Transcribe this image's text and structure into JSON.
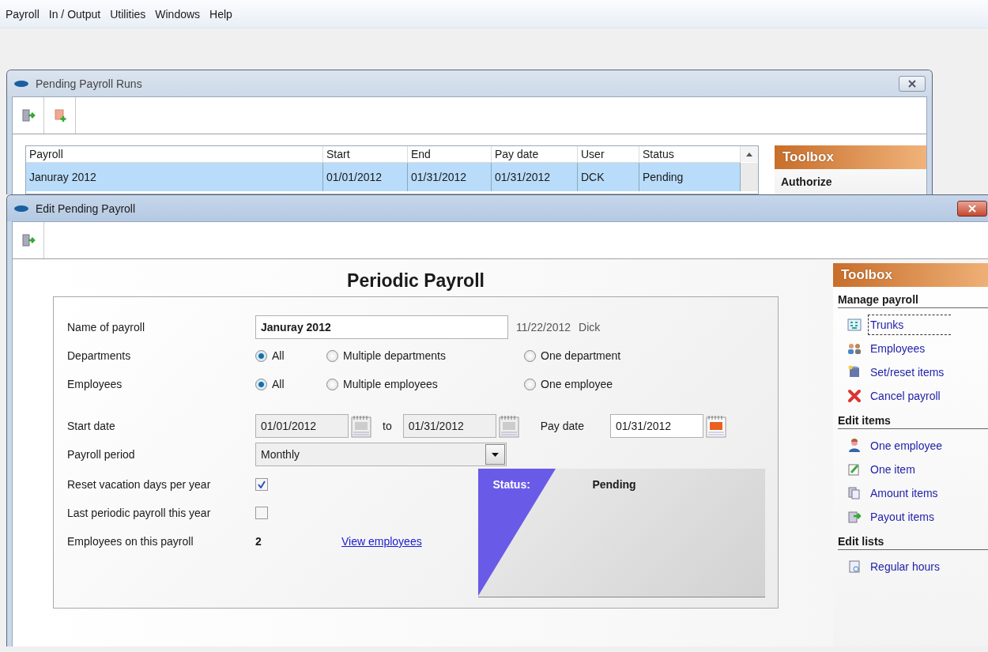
{
  "menu": [
    "Payroll",
    "In / Output",
    "Utilities",
    "Windows",
    "Help"
  ],
  "runs_window": {
    "title": "Pending Payroll Runs",
    "active": false,
    "columns": [
      "Payroll",
      "Start",
      "End",
      "Pay date",
      "User",
      "Status"
    ],
    "rows": [
      {
        "cells": [
          "Januray 2012",
          "01/01/2012",
          "01/31/2012",
          "01/31/2012",
          "DCK",
          "Pending"
        ],
        "selected": true
      }
    ],
    "toolbox": {
      "title": "Toolbox",
      "heading": "Authorize"
    }
  },
  "edit_window": {
    "title": "Edit Pending Payroll",
    "active": true,
    "heading": "Periodic Payroll",
    "form": {
      "name": {
        "label": "Name of payroll",
        "value": "Januray 2012",
        "created": "11/22/2012",
        "user": "Dick"
      },
      "radio_groups": [
        {
          "label": "Departments",
          "options": [
            {
              "label": "All",
              "selected": true
            },
            {
              "label": "Multiple departments",
              "selected": false
            },
            {
              "label": "One department",
              "selected": false
            }
          ]
        },
        {
          "label": "Employees",
          "options": [
            {
              "label": "All",
              "selected": true
            },
            {
              "label": "Multiple employees",
              "selected": false
            },
            {
              "label": "One employee",
              "selected": false
            }
          ]
        }
      ],
      "dates": {
        "start_label": "Start date",
        "to_label": "to",
        "pay_label": "Pay date",
        "fields": [
          {
            "value": "01/01/2012",
            "disabled": true
          },
          {
            "value": "01/31/2012",
            "disabled": true
          },
          {
            "value": "01/31/2012",
            "disabled": false
          }
        ]
      },
      "period": {
        "label": "Payroll period",
        "value": "Monthly"
      },
      "checks": [
        {
          "label": "Reset vacation days per year",
          "checked": true
        },
        {
          "label": "Last periodic payroll this year",
          "checked": false
        }
      ],
      "count": {
        "label": "Employees on this payroll",
        "value": "2",
        "link": "View employees"
      },
      "status": {
        "label": "Status:",
        "value": "Pending"
      }
    },
    "toolbox": {
      "title": "Toolbox",
      "sections": [
        {
          "title": "Manage payroll",
          "items": [
            {
              "label": "Trunks",
              "focused": true
            },
            {
              "label": "Employees",
              "focused": false
            },
            {
              "label": "Set/reset items",
              "focused": false
            },
            {
              "label": "Cancel payroll",
              "focused": false
            }
          ]
        },
        {
          "title": "Edit items",
          "items": [
            {
              "label": "One employee",
              "focused": false
            },
            {
              "label": "One item",
              "focused": false
            },
            {
              "label": "Amount items",
              "focused": false
            },
            {
              "label": "Payout items",
              "focused": false
            }
          ]
        },
        {
          "title": "Edit lists",
          "items": [
            {
              "label": "Regular hours",
              "focused": false
            }
          ]
        }
      ]
    }
  }
}
